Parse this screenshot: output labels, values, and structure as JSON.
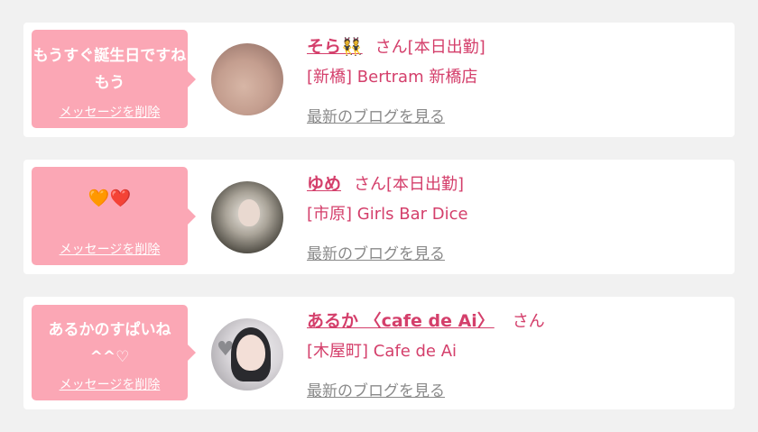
{
  "cards": [
    {
      "message": "もうすぐ誕生日ですねもう",
      "delete_label": "メッセージを削除",
      "name": "そら👯",
      "suffix": "さん[本日出勤]",
      "shop": "[新橋] Bertram 新橋店",
      "blog_link": "最新のブログを見る"
    },
    {
      "message": "🧡❤️",
      "delete_label": "メッセージを削除",
      "name": "ゆめ",
      "suffix": "さん[本日出勤]",
      "shop": "[市原] Girls Bar Dice",
      "blog_link": "最新のブログを見る"
    },
    {
      "message": "あるかのすぱいね^^♡",
      "delete_label": "メッセージを削除",
      "name": "あるか 〈cafe de Ai〉",
      "suffix": "さん",
      "shop": "[木屋町] Cafe de Ai",
      "blog_link": "最新のブログを見る"
    }
  ],
  "colors": {
    "page_bg": "#f1f1f1",
    "bubble_bg": "#fba7b5",
    "accent_pink": "#d43f6b",
    "link_gray": "#8a8a8a"
  }
}
